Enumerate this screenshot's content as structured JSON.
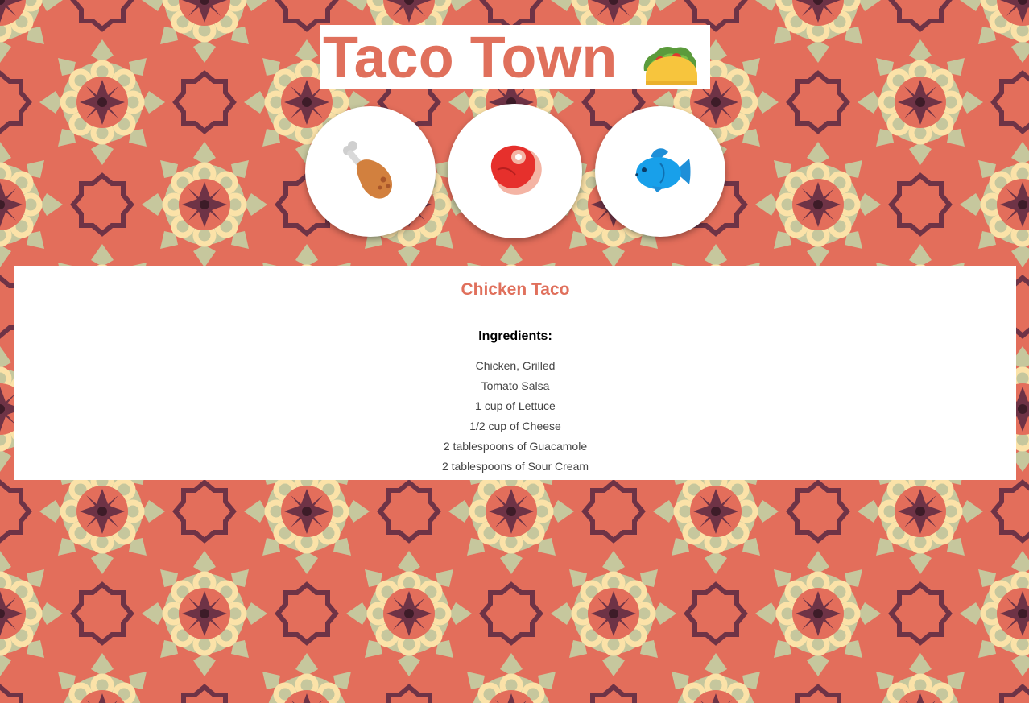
{
  "header": {
    "title": "Taco Town",
    "icon": "taco-icon"
  },
  "filling_buttons": [
    {
      "name": "chicken",
      "icon": "poultry-leg-icon"
    },
    {
      "name": "beef",
      "icon": "cut-of-meat-icon"
    },
    {
      "name": "fish",
      "icon": "fish-icon"
    }
  ],
  "recipe": {
    "title": "Chicken Taco",
    "ingredients_heading": "Ingredients:",
    "ingredients": [
      "Chicken, Grilled",
      "Tomato Salsa",
      "1 cup of Lettuce",
      "1/2 cup of Cheese",
      "2 tablespoons of Guacamole",
      "2 tablespoons of Sour Cream"
    ]
  },
  "colors": {
    "background": "#e36e5b",
    "accent": "#e0705c",
    "pattern_dark": "#6e3346",
    "pattern_cream": "#fbe2a8",
    "pattern_sage": "#c6c79d"
  }
}
